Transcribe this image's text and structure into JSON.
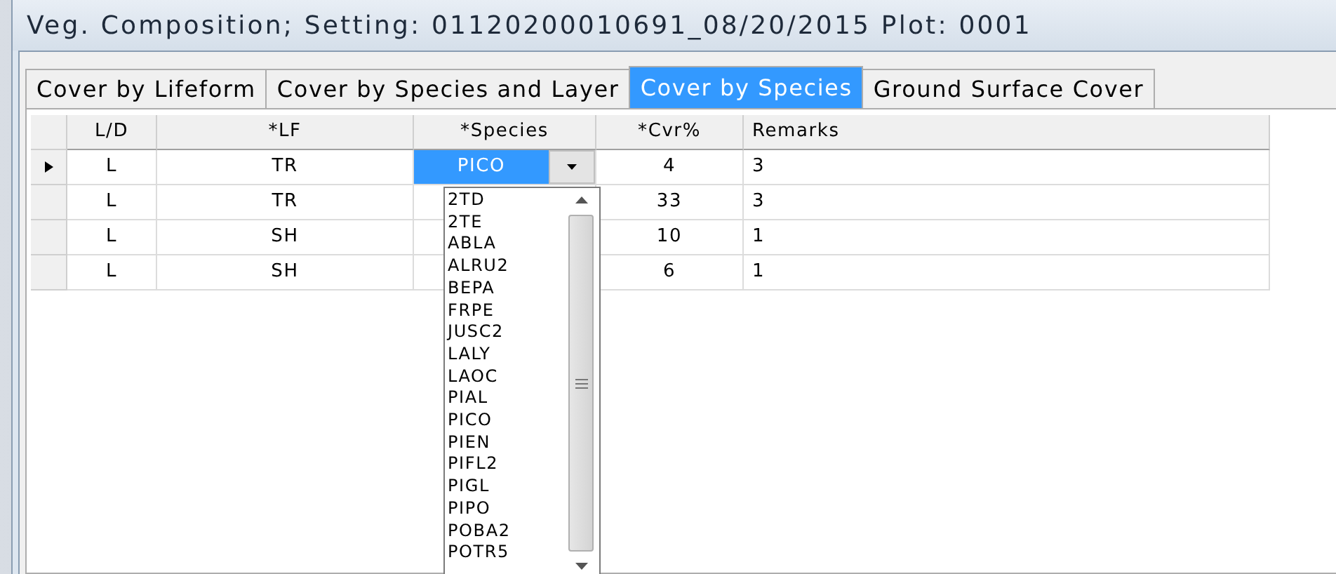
{
  "window": {
    "title": "Veg. Composition; Setting: 01120200010691_08/20/2015 Plot: 0001"
  },
  "tabs": [
    {
      "label": "Cover by Lifeform",
      "selected": false
    },
    {
      "label": "Cover by Species and Layer",
      "selected": false
    },
    {
      "label": "Cover by Species",
      "selected": true
    },
    {
      "label": "Ground Surface Cover",
      "selected": false
    }
  ],
  "table": {
    "columns": [
      "L/D",
      "*LF",
      "*Species",
      "*Cvr%",
      "Remarks"
    ],
    "rows": [
      {
        "current": true,
        "editing": true,
        "cells": [
          "L",
          "TR",
          "PICO",
          "4",
          "3"
        ]
      },
      {
        "current": false,
        "editing": false,
        "cells": [
          "L",
          "TR",
          "",
          "33",
          "3"
        ]
      },
      {
        "current": false,
        "editing": false,
        "cells": [
          "L",
          "SH",
          "",
          "10",
          "1"
        ]
      },
      {
        "current": false,
        "editing": false,
        "cells": [
          "L",
          "SH",
          "",
          "6",
          "1"
        ]
      }
    ]
  },
  "species_dropdown": {
    "items": [
      "2TD",
      "2TE",
      "ABLA",
      "ALRU2",
      "BEPA",
      "FRPE",
      "JUSC2",
      "LALY",
      "LAOC",
      "PIAL",
      "PICO",
      "PIEN",
      "PIFL2",
      "PIGL",
      "PIPO",
      "POBA2",
      "POTR5"
    ]
  }
}
